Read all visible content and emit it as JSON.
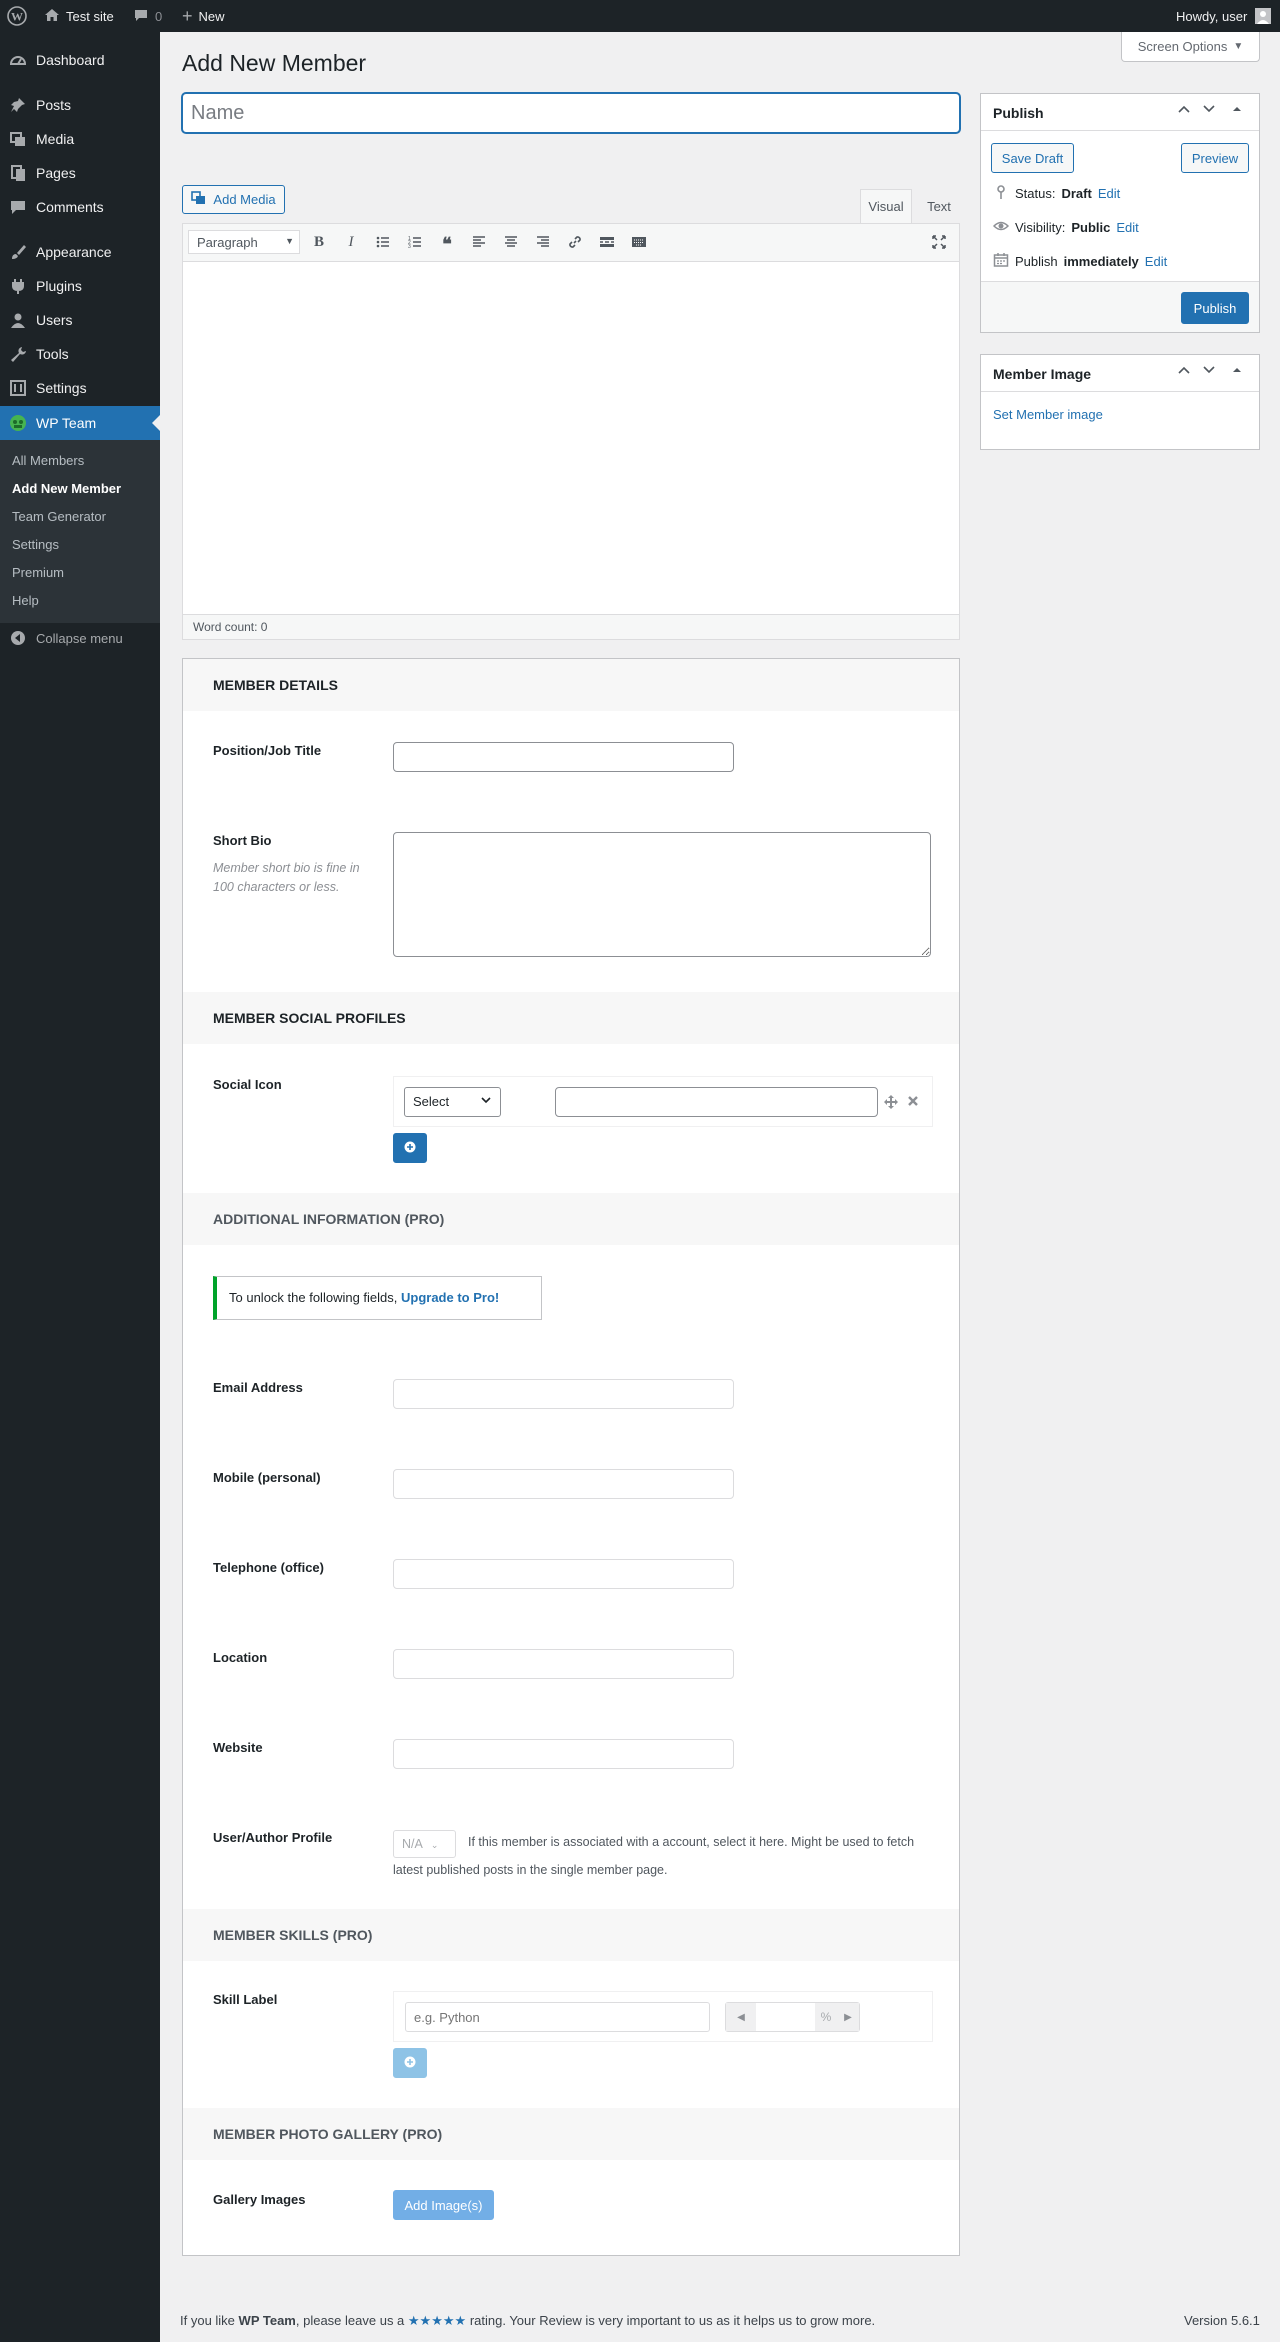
{
  "adminbar": {
    "site_name": "Test site",
    "comments_count": "0",
    "new_label": "New",
    "greeting": "Howdy, user"
  },
  "sidebar": {
    "items": [
      {
        "label": "Dashboard",
        "icon": "dashboard-icon"
      },
      {
        "label": "Posts",
        "icon": "pin-icon"
      },
      {
        "label": "Media",
        "icon": "media-icon"
      },
      {
        "label": "Pages",
        "icon": "pages-icon"
      },
      {
        "label": "Comments",
        "icon": "comments-icon"
      },
      {
        "label": "Appearance",
        "icon": "paintbrush-icon"
      },
      {
        "label": "Plugins",
        "icon": "plugin-icon"
      },
      {
        "label": "Users",
        "icon": "users-icon"
      },
      {
        "label": "Tools",
        "icon": "wrench-icon"
      },
      {
        "label": "Settings",
        "icon": "settings-icon"
      },
      {
        "label": "WP Team",
        "icon": "team-icon"
      }
    ],
    "submenu": [
      "All Members",
      "Add New Member",
      "Team Generator",
      "Settings",
      "Premium",
      "Help"
    ],
    "collapse_label": "Collapse menu"
  },
  "screen_options_label": "Screen Options",
  "page_title": "Add New Member",
  "title_placeholder": "Name",
  "editor": {
    "add_media_label": "Add Media",
    "tab_visual": "Visual",
    "tab_text": "Text",
    "format_select": "Paragraph",
    "word_count": "Word count: 0"
  },
  "publish": {
    "title": "Publish",
    "save_draft": "Save Draft",
    "preview": "Preview",
    "status_label": "Status:",
    "status_value": "Draft",
    "visibility_label": "Visibility:",
    "visibility_value": "Public",
    "publish_label": "Publish",
    "publish_value": "immediately",
    "edit": "Edit",
    "publish_button": "Publish"
  },
  "member_image": {
    "title": "Member Image",
    "link": "Set Member image"
  },
  "details": {
    "section_title": "MEMBER DETAILS",
    "position_label": "Position/Job Title",
    "bio_label": "Short Bio",
    "bio_help": "Member short bio is fine in 100 characters or less.",
    "social_section": "MEMBER SOCIAL PROFILES",
    "social_label": "Social Icon",
    "social_select": "Select",
    "additional_section": "ADDITIONAL INFORMATION (PRO)",
    "unlock_text": "To unlock the following fields,",
    "unlock_link": "Upgrade to Pro!",
    "email_label": "Email Address",
    "mobile_label": "Mobile (personal)",
    "telephone_label": "Telephone (office)",
    "location_label": "Location",
    "website_label": "Website",
    "user_label": "User/Author Profile",
    "user_select": "N/A",
    "user_help": "If this member is associated with a account, select it here. Might be used to fetch latest published posts in the single member page.",
    "skills_section": "MEMBER SKILLS (PRO)",
    "skill_label": "Skill Label",
    "skill_placeholder": "e.g. Python",
    "percent": "%",
    "gallery_section": "MEMBER PHOTO GALLERY (PRO)",
    "gallery_label": "Gallery Images",
    "gallery_button": "Add Image(s)"
  },
  "footer": {
    "text_before": "If you like",
    "plugin_name": "WP Team",
    "text_middle": ", please leave us a",
    "stars": "★★★★★",
    "text_after": "rating. Your Review is very important to us as it helps us to grow more.",
    "version": "Version 5.6.1"
  },
  "colors": {
    "accent": "#2271b1",
    "adminbar": "#1d2327",
    "notice_border": "#00a32a"
  }
}
